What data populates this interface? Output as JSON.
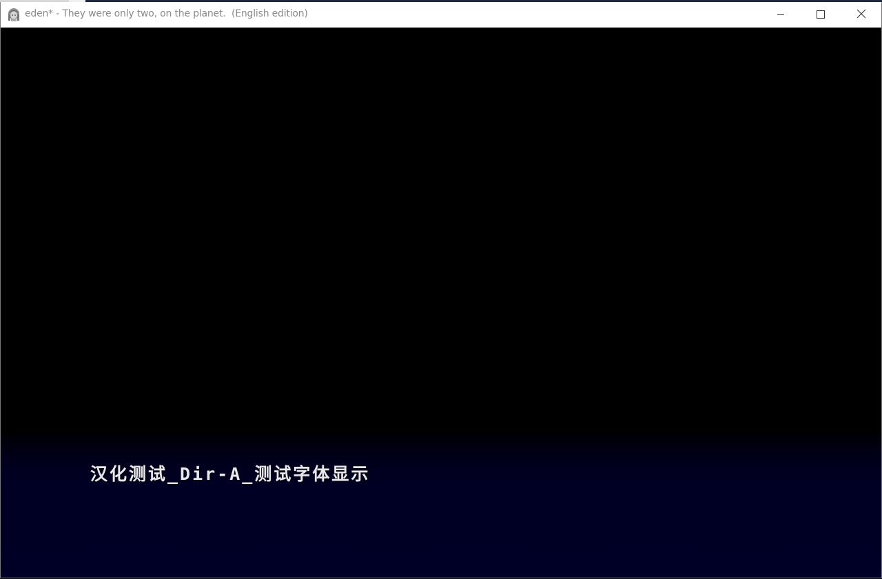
{
  "window": {
    "title": "eden* - They were only two, on the planet.  (English edition)",
    "icon": "character-face-icon",
    "controls": {
      "minimize": "minimize-icon",
      "maximize": "maximize-icon",
      "close": "close-icon"
    }
  },
  "game": {
    "dialogue_text": "汉化测试_Dir-A_测试字体显示",
    "colors": {
      "background": "#000000",
      "textbox": "#000026",
      "text": "#e8e8f0"
    }
  }
}
